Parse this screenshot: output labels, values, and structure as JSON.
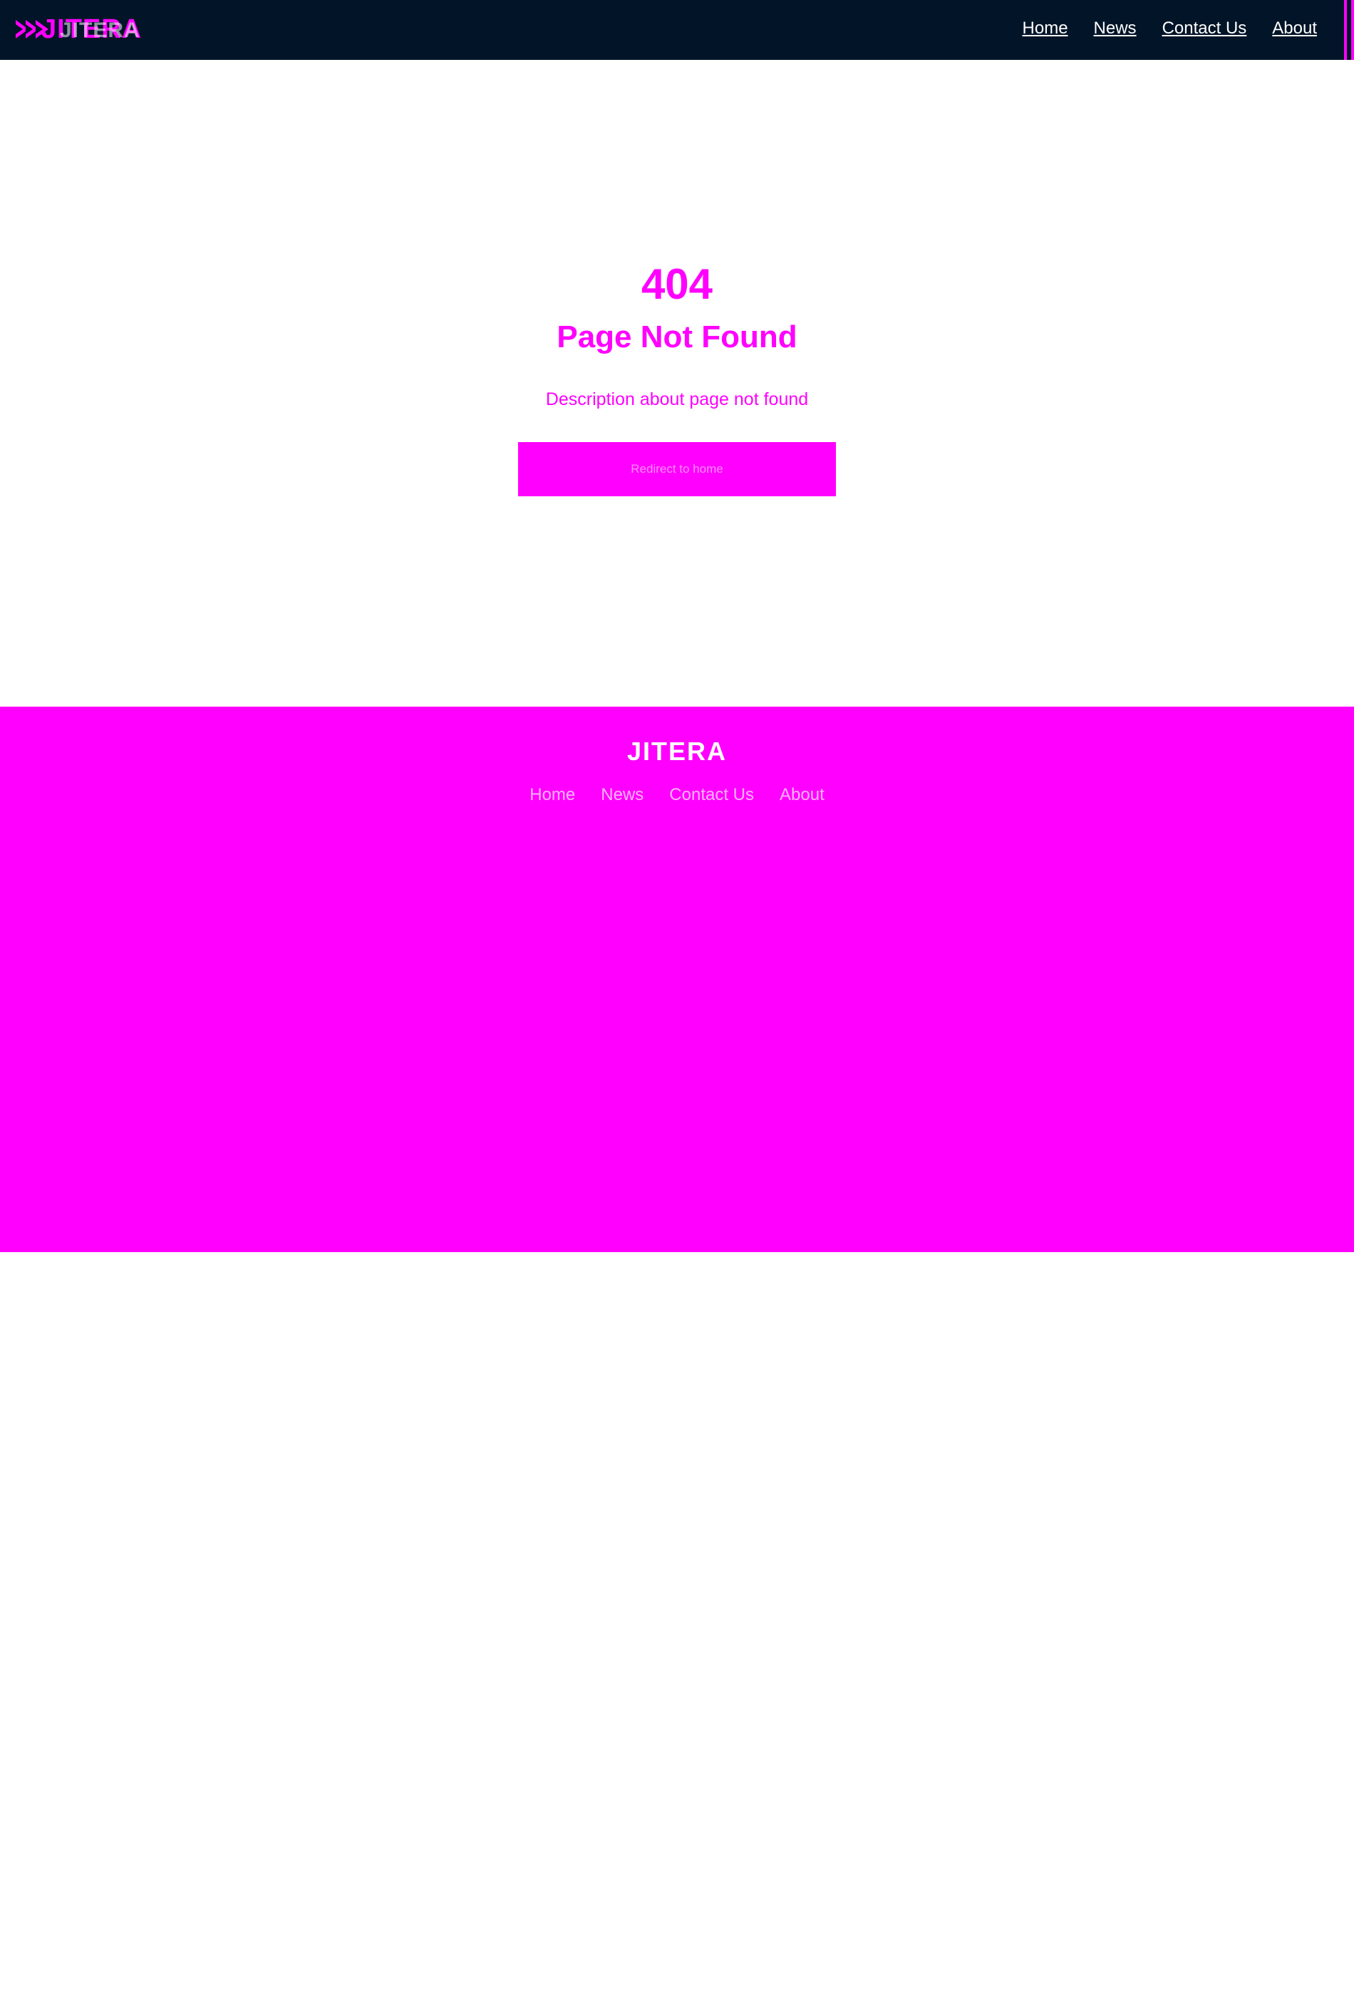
{
  "header": {
    "logo_text": "JITERA",
    "nav": [
      "Home",
      "News",
      "Contact Us",
      "About"
    ]
  },
  "main": {
    "code": "404",
    "title": "Page Not Found",
    "description": "Description about page not found",
    "button_label": "Redirect to home"
  },
  "footer": {
    "logo_text": "JITERA",
    "nav": [
      "Home",
      "News",
      "Contact Us",
      "About"
    ]
  },
  "colors": {
    "header_bg": "#021528",
    "accent": "#ff00ff",
    "background": "#ffffff"
  }
}
